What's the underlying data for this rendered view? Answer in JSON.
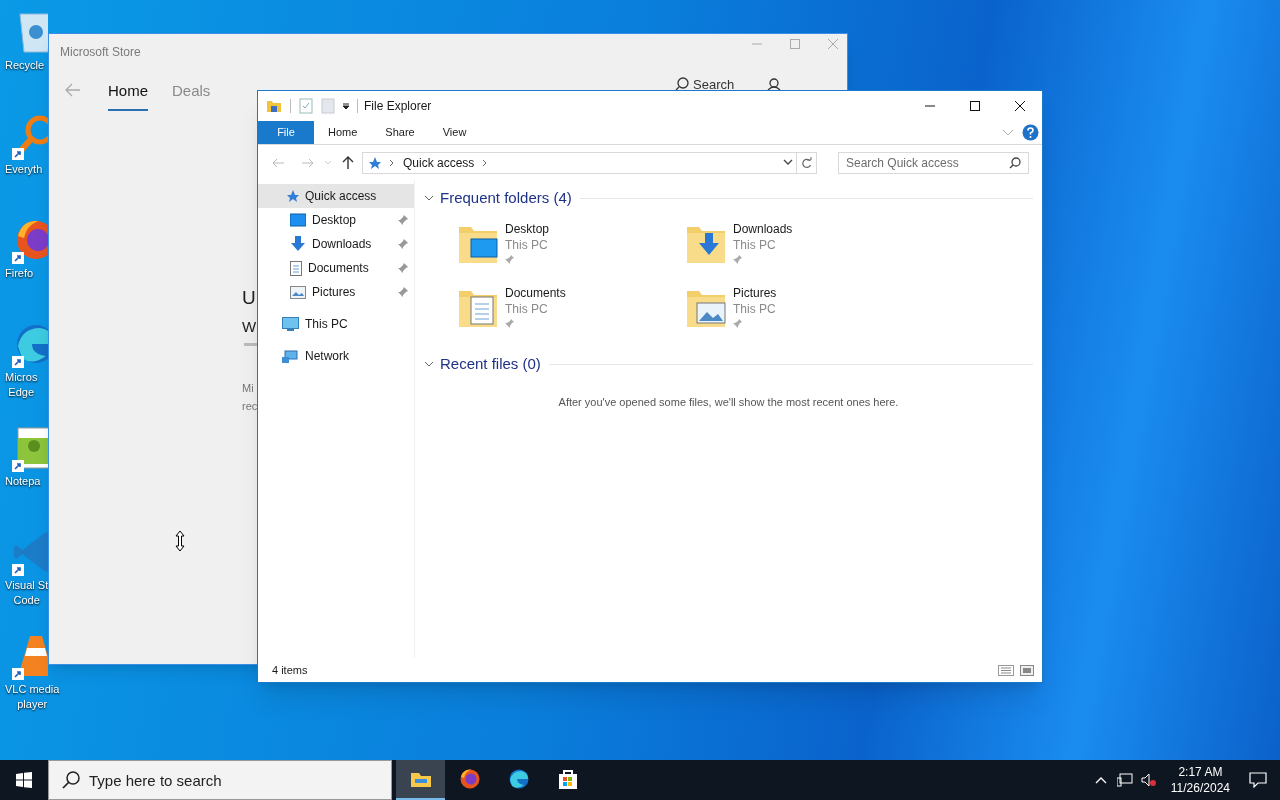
{
  "desktop_icons": [
    {
      "kind": "recycle",
      "lines": [
        "Recycle"
      ],
      "shortcut": false
    },
    {
      "kind": "everything",
      "lines": [
        "Everyth"
      ],
      "shortcut": true
    },
    {
      "kind": "firefox",
      "lines": [
        "Firefo"
      ],
      "shortcut": true
    },
    {
      "kind": "edge",
      "lines": [
        "Micros",
        "Edge"
      ],
      "shortcut": true
    },
    {
      "kind": "notepad",
      "lines": [
        "Notepa"
      ],
      "shortcut": true
    },
    {
      "kind": "vscode",
      "lines": [
        "Visual St",
        "Code"
      ],
      "shortcut": true
    },
    {
      "kind": "vlc",
      "lines": [
        "VLC media",
        "player"
      ],
      "shortcut": true
    }
  ],
  "store_window": {
    "title": "Microsoft Store",
    "tabs": [
      {
        "label": "Home",
        "selected": true
      },
      {
        "label": "Deals",
        "selected": false
      }
    ],
    "search_label": "Search",
    "content_fragments": [
      "U",
      "W",
      "Mi",
      "rec"
    ]
  },
  "explorer": {
    "title": "File Explorer",
    "ribbon_tabs": [
      {
        "label": "File",
        "kind": "file"
      },
      {
        "label": "Home",
        "kind": "tab"
      },
      {
        "label": "Share",
        "kind": "tab"
      },
      {
        "label": "View",
        "kind": "tab"
      }
    ],
    "address": {
      "breadcrumb": "Quick access"
    },
    "search": {
      "placeholder": "Search Quick access"
    },
    "nav": [
      {
        "label": "Quick access",
        "kind": "quick",
        "selected": true,
        "children": [
          {
            "label": "Desktop",
            "kind": "desktop",
            "pinned": true,
            "selected": false
          },
          {
            "label": "Downloads",
            "kind": "downloads",
            "pinned": true,
            "selected": false
          },
          {
            "label": "Documents",
            "kind": "documents",
            "pinned": true,
            "selected": false
          },
          {
            "label": "Pictures",
            "kind": "pictures",
            "pinned": true,
            "selected": false
          }
        ]
      },
      {
        "label": "This PC",
        "kind": "pc",
        "selected": false
      },
      {
        "label": "Network",
        "kind": "network",
        "selected": false
      }
    ],
    "sections": [
      {
        "title": "Frequent folders (4)",
        "expanded": true,
        "folders": [
          {
            "name": "Desktop",
            "location": "This PC",
            "kind": "desktop",
            "pinned": true
          },
          {
            "name": "Downloads",
            "location": "This PC",
            "kind": "downloads",
            "pinned": true
          },
          {
            "name": "Documents",
            "location": "This PC",
            "kind": "documents",
            "pinned": true
          },
          {
            "name": "Pictures",
            "location": "This PC",
            "kind": "pictures",
            "pinned": true
          }
        ]
      },
      {
        "title": "Recent files (0)",
        "expanded": true,
        "empty_message": "After you've opened some files, we'll show the most recent ones here."
      }
    ],
    "status": "4 items"
  },
  "taskbar": {
    "search_placeholder": "Type here to search",
    "apps": [
      {
        "kind": "explorer",
        "active": true
      },
      {
        "kind": "firefox",
        "active": false
      },
      {
        "kind": "edge",
        "active": false
      },
      {
        "kind": "store",
        "active": false
      }
    ],
    "time": "2:17 AM",
    "date": "11/26/2024"
  }
}
